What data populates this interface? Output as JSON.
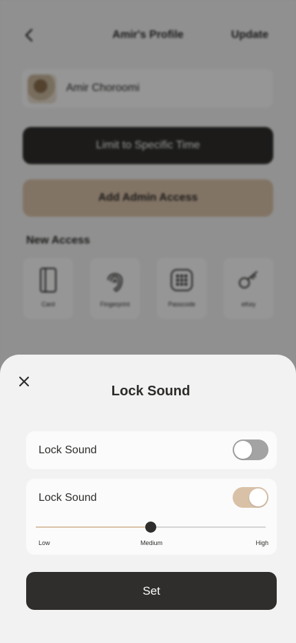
{
  "background": {
    "header": {
      "title": "Amir's Profile",
      "action": "Update"
    },
    "profile": {
      "name": "Amir Choroomi"
    },
    "buttons": {
      "limit_time": "Limit to Specific Time",
      "admin_access": "Add Admin Access"
    },
    "new_access": {
      "title": "New Access",
      "tiles": [
        {
          "label": "Card",
          "icon": "card-icon"
        },
        {
          "label": "Fingerprint",
          "icon": "fingerprint-icon"
        },
        {
          "label": "Passcode",
          "icon": "passcode-icon"
        },
        {
          "label": "eKey",
          "icon": "ekey-icon"
        }
      ]
    }
  },
  "sheet": {
    "title": "Lock Sound",
    "close_icon": "close-icon",
    "rows": [
      {
        "label": "Lock Sound",
        "toggle": "off"
      },
      {
        "label": "Lock Sound",
        "toggle": "on"
      }
    ],
    "volume": {
      "level": 0.5,
      "ticks": {
        "low": "Low",
        "medium": "Medium",
        "high": "High"
      }
    },
    "set_label": "Set"
  },
  "colors": {
    "dark": "#2f2e2c",
    "accent": "#d9c1a8",
    "toggle_off": "#a3a3a3",
    "sheet_bg": "#f2f2f2",
    "card_bg": "#fbfbfb"
  }
}
